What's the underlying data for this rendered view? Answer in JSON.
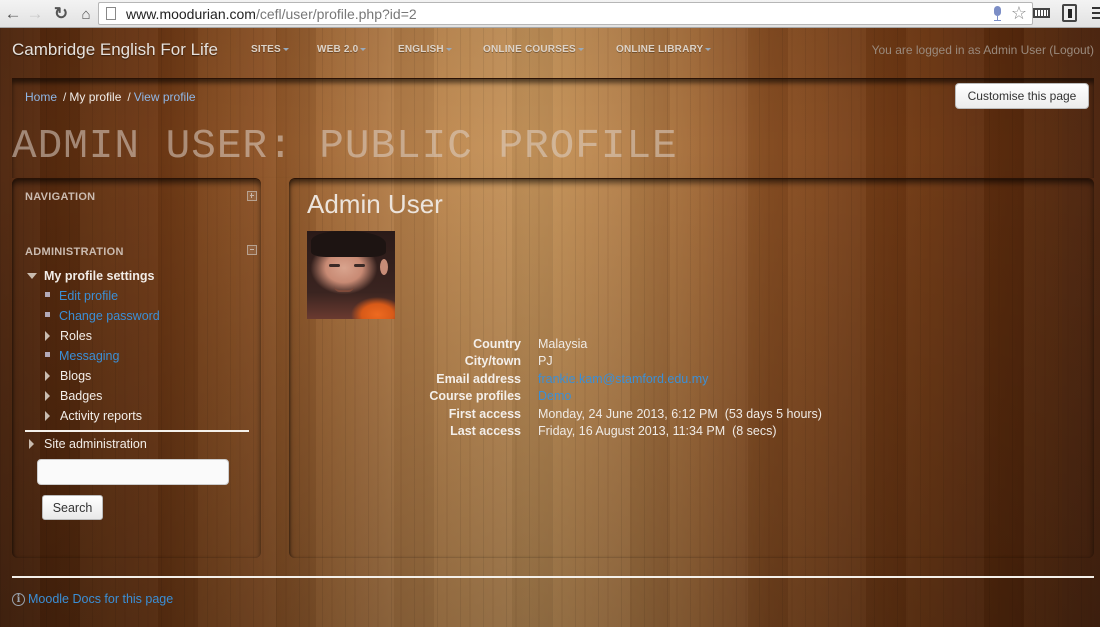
{
  "browser": {
    "url_host": "www.moodurian.com",
    "url_path": "/cefl/user/profile.php?id=2",
    "back_icon": "arrow-left-icon",
    "forward_icon": "arrow-right-icon",
    "reload_icon": "reload-icon",
    "home_icon": "home-icon"
  },
  "navbar": {
    "brand": "Cambridge English For Life",
    "items": [
      {
        "label": "SITES"
      },
      {
        "label": "WEB 2.0"
      },
      {
        "label": "ENGLISH"
      },
      {
        "label": "ONLINE COURSES"
      },
      {
        "label": "ONLINE LIBRARY"
      }
    ],
    "login_prefix": "You are logged in as ",
    "login_user": "Admin User",
    "logout_label": "(Logout)"
  },
  "breadcrumb": {
    "items": [
      {
        "label": "Home",
        "link": true
      },
      {
        "label": "My profile",
        "link": false
      },
      {
        "label": "View profile",
        "link": true
      }
    ],
    "separator": "/"
  },
  "header": {
    "customise_label": "Customise this page",
    "page_heading": "ADMIN USER: PUBLIC PROFILE"
  },
  "sidebar": {
    "navigation_title": "NAVIGATION",
    "administration_title": "ADMINISTRATION",
    "my_profile_settings": "My profile settings",
    "items": [
      {
        "label": "Edit profile",
        "type": "link"
      },
      {
        "label": "Change password",
        "type": "link"
      },
      {
        "label": "Roles",
        "type": "branch"
      },
      {
        "label": "Messaging",
        "type": "link"
      },
      {
        "label": "Blogs",
        "type": "branch"
      },
      {
        "label": "Badges",
        "type": "branch"
      },
      {
        "label": "Activity reports",
        "type": "branch"
      }
    ],
    "site_administration": "Site administration",
    "search_value": "",
    "search_button": "Search"
  },
  "profile": {
    "name": "Admin User",
    "fields": [
      {
        "label": "Country",
        "value": "Malaysia",
        "link": false
      },
      {
        "label": "City/town",
        "value": "PJ",
        "link": false
      },
      {
        "label": "Email address",
        "value": "frankie.kam@stamford.edu.my",
        "link": true
      },
      {
        "label": "Course profiles",
        "value": "Demo",
        "link": true
      },
      {
        "label": "First access",
        "value": "Monday, 24 June 2013, 6:12 PM  (53 days 5 hours)",
        "link": false
      },
      {
        "label": "Last access",
        "value": "Friday, 16 August 2013, 11:34 PM  (8 secs)",
        "link": false
      }
    ]
  },
  "footer": {
    "docs_link": "Moodle Docs for this page"
  },
  "colors": {
    "link": "#3b8fd6",
    "breadcrumb_link": "#8fb6e5"
  }
}
